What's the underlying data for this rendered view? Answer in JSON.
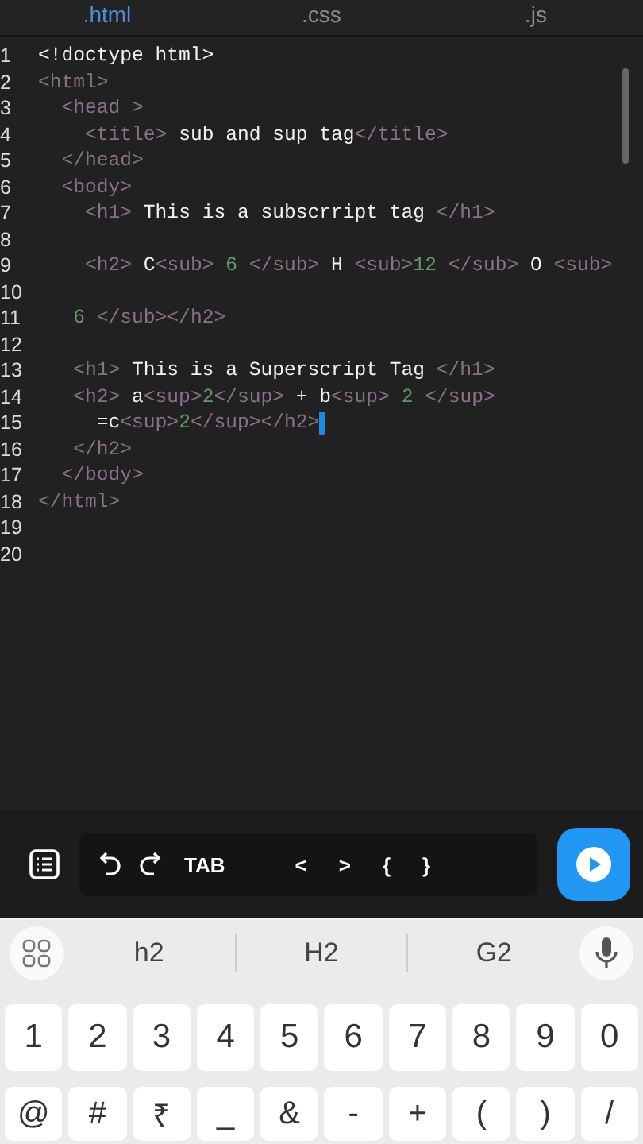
{
  "tabs": [
    {
      "label": ".html",
      "selected": true
    },
    {
      "label": ".css",
      "selected": false
    },
    {
      "label": ".js",
      "selected": false
    }
  ],
  "editor": {
    "lines": [
      {
        "number": "1",
        "tokens": [
          {
            "kind": "text",
            "text": "<!doctype html>"
          }
        ]
      },
      {
        "number": "2",
        "tokens": [
          {
            "kind": "tag",
            "text": "<html>"
          }
        ]
      },
      {
        "number": "3",
        "tokens": [
          {
            "kind": "tag",
            "text": "  <head >"
          }
        ]
      },
      {
        "number": "4",
        "tokens": [
          {
            "kind": "tag",
            "text": "    <title>"
          },
          {
            "kind": "text",
            "text": " sub and sup tag"
          },
          {
            "kind": "tag",
            "text": "</title>"
          }
        ]
      },
      {
        "number": "5",
        "tokens": [
          {
            "kind": "tag",
            "text": "  </head>"
          }
        ]
      },
      {
        "number": "6",
        "tokens": [
          {
            "kind": "tag",
            "text": "  <body>"
          }
        ]
      },
      {
        "number": "7",
        "tokens": [
          {
            "kind": "tag",
            "text": "    <h1>"
          },
          {
            "kind": "text",
            "text": " This is a subscrript tag "
          },
          {
            "kind": "tag",
            "text": "</h1>"
          }
        ]
      },
      {
        "number": "8"
      },
      {
        "number": "9",
        "tokens": [
          {
            "kind": "tag",
            "text": "    <h2>"
          },
          {
            "kind": "text",
            "text": " C"
          },
          {
            "kind": "tag",
            "text": "<sub>"
          },
          {
            "kind": "num",
            "text": " 6 "
          },
          {
            "kind": "tag",
            "text": "</sub>"
          },
          {
            "kind": "text",
            "text": " H "
          },
          {
            "kind": "tag",
            "text": "<sub>"
          },
          {
            "kind": "num",
            "text": "12 "
          },
          {
            "kind": "tag",
            "text": "</sub>"
          },
          {
            "kind": "text",
            "text": " O "
          },
          {
            "kind": "tag",
            "text": "<sub>"
          }
        ]
      },
      {
        "number": "10"
      },
      {
        "number": "11",
        "tokens": [
          {
            "kind": "num",
            "text": "   6 "
          },
          {
            "kind": "tag",
            "text": "</sub></h2>"
          }
        ]
      },
      {
        "number": "12"
      },
      {
        "number": "13",
        "tokens": [
          {
            "kind": "tag",
            "text": "   <h1>"
          },
          {
            "kind": "text",
            "text": " This is a Superscript Tag "
          },
          {
            "kind": "tag",
            "text": "</h1>"
          }
        ]
      },
      {
        "number": "14",
        "tokens": [
          {
            "kind": "tag",
            "text": "   <h2>"
          },
          {
            "kind": "text",
            "text": " a"
          },
          {
            "kind": "tag",
            "text": "<sup>"
          },
          {
            "kind": "num",
            "text": "2"
          },
          {
            "kind": "tag",
            "text": "</sup>"
          },
          {
            "kind": "text",
            "text": " + b"
          },
          {
            "kind": "tag",
            "text": "<sup>"
          },
          {
            "kind": "num",
            "text": " 2 "
          },
          {
            "kind": "tag",
            "text": "</sup>"
          }
        ]
      },
      {
        "number": "15",
        "cursor": true,
        "tokens": [
          {
            "kind": "text",
            "text": "     =c"
          },
          {
            "kind": "tag",
            "text": "<sup>"
          },
          {
            "kind": "num",
            "text": "2"
          },
          {
            "kind": "tag",
            "text": "</sup></h2>"
          }
        ]
      },
      {
        "number": "16",
        "tokens": [
          {
            "kind": "tag",
            "text": "   </h2>"
          }
        ]
      },
      {
        "number": "17",
        "tokens": [
          {
            "kind": "tag",
            "text": "  </body>"
          }
        ]
      },
      {
        "number": "18",
        "tokens": [
          {
            "kind": "tag",
            "text": "</html>"
          }
        ]
      },
      {
        "number": "19"
      },
      {
        "number": "20"
      }
    ]
  },
  "toolbar": {
    "keys": [
      "TAB",
      "<",
      ">",
      "{",
      "}"
    ]
  },
  "keyboard": {
    "suggestions": [
      "h2",
      "H2",
      "G2"
    ],
    "rows": [
      [
        "1",
        "2",
        "3",
        "4",
        "5",
        "6",
        "7",
        "8",
        "9",
        "0"
      ],
      [
        "@",
        "#",
        "₹",
        "_",
        "&",
        "-",
        "+",
        "(",
        ")",
        "/"
      ]
    ]
  }
}
